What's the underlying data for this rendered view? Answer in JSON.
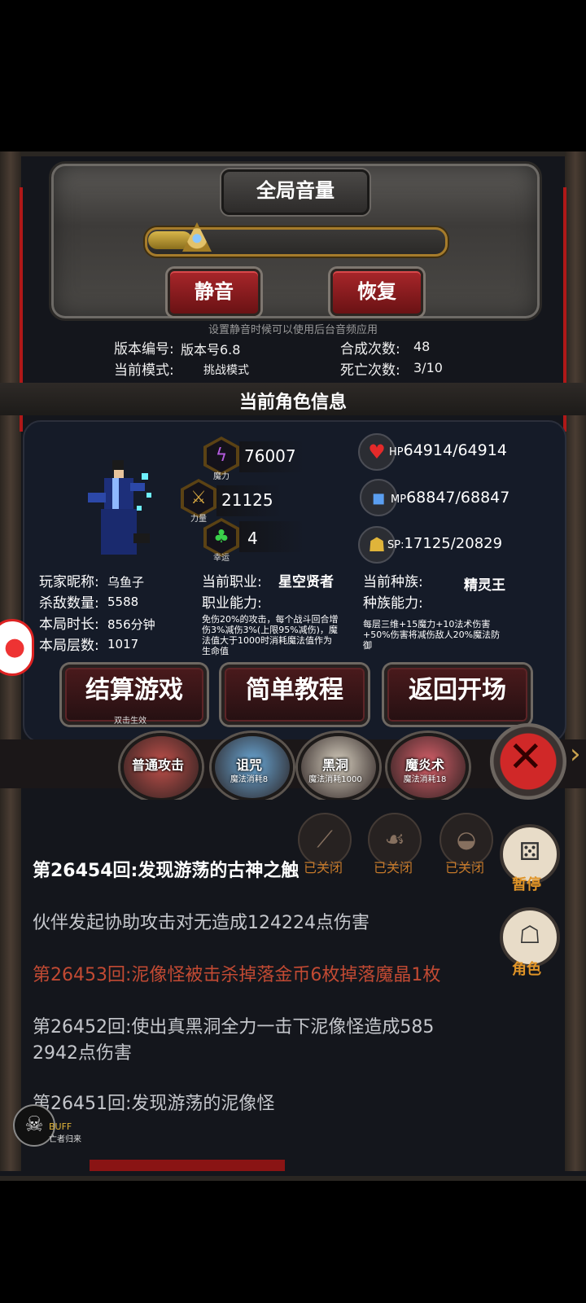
{
  "volume": {
    "title": "全局音量",
    "level": 0.15,
    "mute_label": "静音",
    "restore_label": "恢复",
    "hint": "设置静音时候可以使用后台音频应用"
  },
  "game_info": {
    "version_label": "版本编号:",
    "version_value": "版本号6.8",
    "mode_label": "当前模式:",
    "mode_value": "挑战模式",
    "craft_label": "合成次数:",
    "craft_value": "48",
    "death_label": "死亡次数:",
    "death_value": "3/10"
  },
  "character": {
    "section_title": "当前角色信息",
    "stats": [
      {
        "caption": "魔力",
        "value": "76007",
        "icon": "lightning-icon"
      },
      {
        "caption": "力量",
        "value": "21125",
        "icon": "spear-icon"
      },
      {
        "caption": "幸运",
        "value": "4",
        "icon": "clover-icon"
      }
    ],
    "vitals": [
      {
        "prefix": "HP",
        "value": "64914/64914",
        "icon": "heart-icon"
      },
      {
        "prefix": "MP",
        "value": "68847/68847",
        "icon": "mana-icon"
      },
      {
        "prefix": "SP:",
        "value": "17125/20829",
        "icon": "strength-icon"
      }
    ],
    "player": {
      "nickname_label": "玩家昵称:",
      "nickname_value": "乌鱼子",
      "kills_label": "杀敌数量:",
      "kills_value": "5588",
      "time_label": "本局时长:",
      "time_value": "856分钟",
      "floor_label": "本局层数:",
      "floor_value": "1017"
    },
    "job": {
      "label": "当前职业:",
      "value": "星空贤者",
      "ability_label": "职业能力:",
      "ability_desc": "免伤20%的攻击，每个战斗回合增伤3%减伤3%(上限95%减伤)，魔法值大于1000时消耗魔法值作为生命值"
    },
    "race": {
      "label": "当前种族:",
      "value": "精灵王",
      "ability_label": "种族能力:",
      "ability_desc": "每层三维+15魔力+10法术伤害+50%伤害将减伤敌人20%魔法防御"
    }
  },
  "actions": {
    "settle_label": "结算游戏",
    "settle_hint": "双击生效",
    "tutorial_label": "简单教程",
    "return_label": "返回开场"
  },
  "skills": [
    {
      "name": "普通攻击",
      "cost": "",
      "color": "#c0504a"
    },
    {
      "name": "诅咒",
      "cost": "魔法消耗8",
      "color": "#6aa9d8"
    },
    {
      "name": "黑洞",
      "cost": "魔法消耗1000",
      "color": "#d8d0c0"
    },
    {
      "name": "魔炎术",
      "cost": "魔法消耗18",
      "color": "#d8606a"
    }
  ],
  "toggles": [
    {
      "label": "已关闭",
      "icon": "claw-icon"
    },
    {
      "label": "已关闭",
      "icon": "dragon-icon"
    },
    {
      "label": "已关闭",
      "icon": "bag-icon"
    }
  ],
  "side_buttons": {
    "pause_label": "暂停",
    "role_label": "角色"
  },
  "log": [
    "第26454回:发现游荡的古神之触",
    "伙伴发起协助攻击对无造成124224点伤害",
    "第26453回:泥像怪被击杀掉落金币6枚掉落魔晶1枚",
    "第26452回:使出真黑洞全力一击下泥像怪造成585",
    "2942点伤害",
    "第26451回:发现游荡的泥像怪"
  ],
  "buff": {
    "label": "BUFF",
    "sub": "亡者归来"
  }
}
